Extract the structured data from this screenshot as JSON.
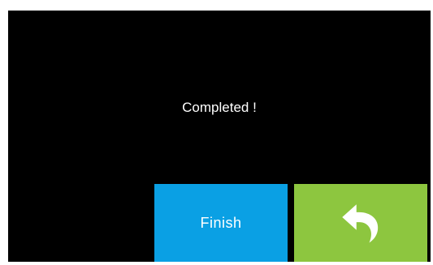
{
  "dialog": {
    "message": "Completed !"
  },
  "buttons": {
    "finish_label": "Finish",
    "back_icon": "return-arrow-icon"
  },
  "colors": {
    "background": "#000000",
    "finish_button": "#0aa0e4",
    "back_button": "#8dc63f",
    "text": "#ffffff"
  }
}
